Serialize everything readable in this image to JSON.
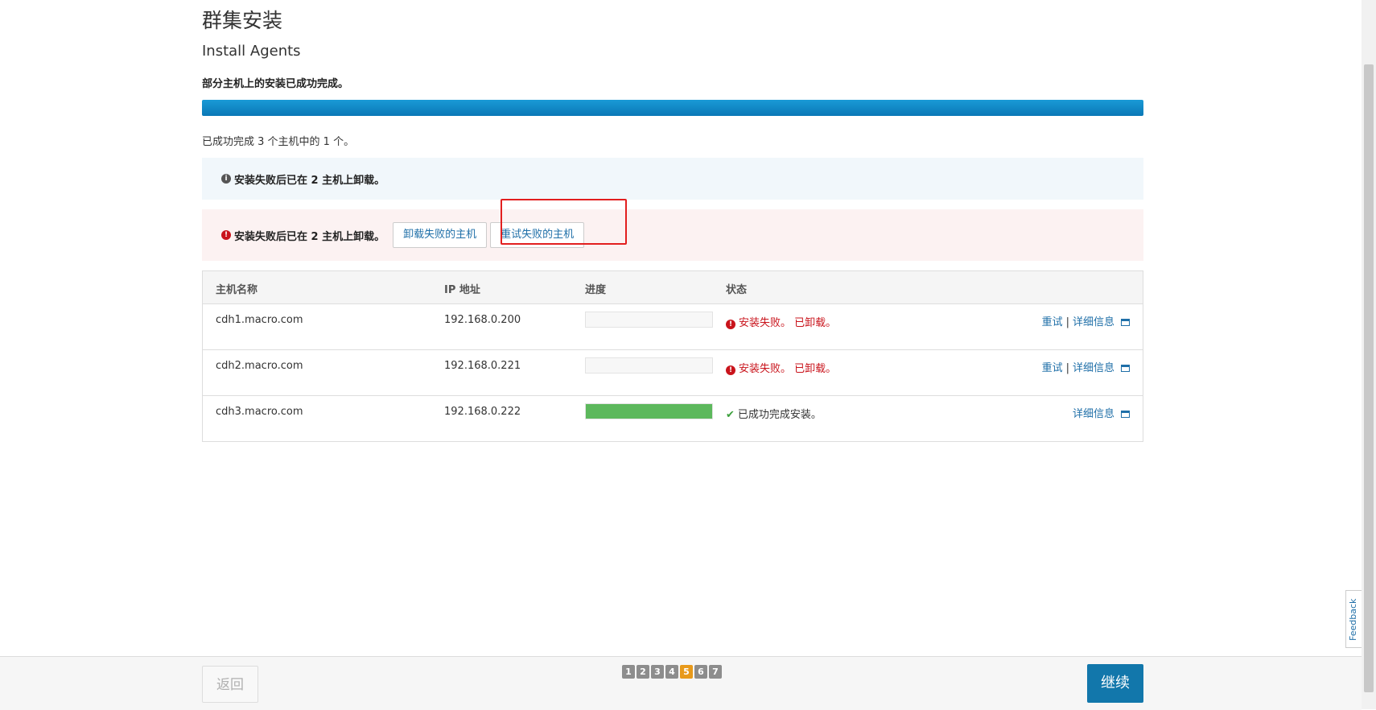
{
  "page": {
    "title": "群集安装",
    "subtitle": "Install Agents",
    "summary": "部分主机上的安装已成功完成。",
    "overall_progress": 1.0,
    "progress_text": "已成功完成 3 个主机中的 1 个。"
  },
  "alerts": {
    "info_text": "安装失败后已在 2 主机上卸载。",
    "danger_text": "安装失败后已在 2 主机上卸载。",
    "uninstall_failed_button": "卸载失败的主机",
    "retry_failed_button": "重试失败的主机"
  },
  "table": {
    "headers": {
      "host": "主机名称",
      "ip": "IP 地址",
      "progress": "进度",
      "status": "状态"
    },
    "rows": [
      {
        "host": "cdh1.macro.com",
        "ip": "192.168.0.200",
        "progress": 0,
        "status": "安装失败。 已卸载。",
        "status_type": "fail",
        "retry": "重试",
        "sep": "|",
        "details": "详细信息"
      },
      {
        "host": "cdh2.macro.com",
        "ip": "192.168.0.221",
        "progress": 0,
        "status": "安装失败。 已卸载。",
        "status_type": "fail",
        "retry": "重试",
        "sep": "|",
        "details": "详细信息"
      },
      {
        "host": "cdh3.macro.com",
        "ip": "192.168.0.222",
        "progress": 1.0,
        "status": "已成功完成安装。",
        "status_type": "ok",
        "details": "详细信息"
      }
    ]
  },
  "footer": {
    "back_label": "返回",
    "continue_label": "继续",
    "steps": [
      "1",
      "2",
      "3",
      "4",
      "5",
      "6",
      "7"
    ],
    "active_step": "5"
  },
  "feedback_label": "Feedback",
  "colors": {
    "accent": "#1277ab",
    "error": "#c9141c",
    "success": "#5cb85c",
    "step_active": "#e89a1b"
  },
  "icons": {
    "info": "info-circle-icon",
    "error": "exclamation-circle-icon",
    "success": "check-icon",
    "details": "window-icon"
  }
}
